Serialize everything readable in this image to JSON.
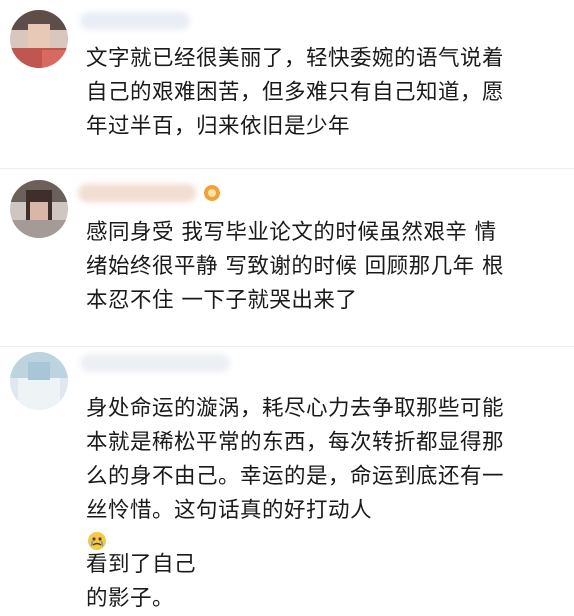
{
  "comments": [
    {
      "lines": [
        "文字就已经很美丽了，轻快委婉的语气说着",
        "自己的艰难困苦，但多难只有自己知道，愿",
        "年过半百，归来依旧是少年"
      ]
    },
    {
      "lines": [
        "感同身受 我写毕业论文的时候虽然艰辛 情",
        "绪始终很平静 写致谢的时候 回顾那几年 根",
        "本忍不住 一下子就哭出来了"
      ],
      "badge_icon": "level-badge-icon"
    },
    {
      "lines": [
        "身处命运的漩涡，耗尽心力去争取那些可能",
        "本就是稀松平常的东西，每次转折都显得那",
        "么的身不由己。幸运的是，命运到底还有一",
        "丝怜惜。这句话真的好打动人"
      ],
      "line4_after_emoji": "看到了自己",
      "line5": "的影子。",
      "inline_emoji": "crying-face-emoji-icon"
    }
  ],
  "colors": {
    "text": "#1a1a1a",
    "divider": "#ececec",
    "badge": "#f0a23a"
  }
}
